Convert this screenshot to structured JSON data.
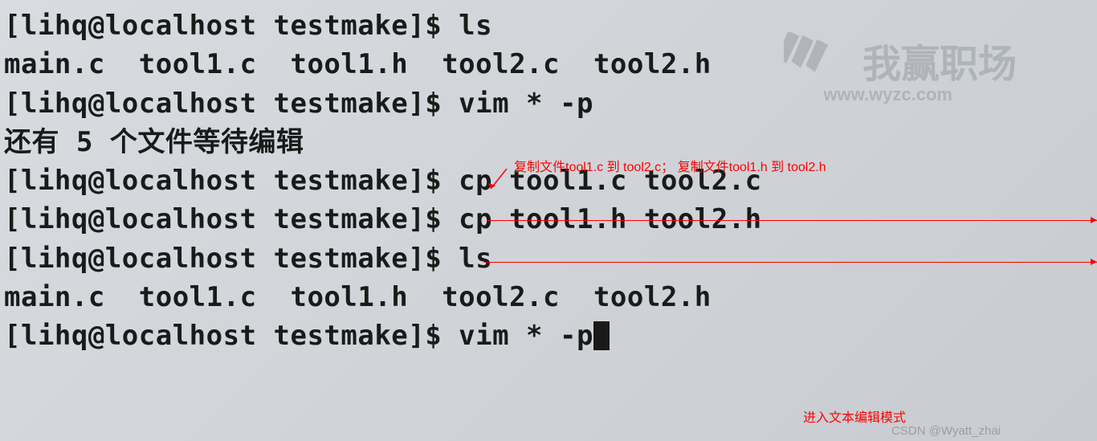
{
  "terminal": {
    "lines": [
      "[lihq@localhost testmake]$ ls",
      "main.c  tool1.c  tool1.h  tool2.c  tool2.h",
      "[lihq@localhost testmake]$ vim * -p",
      "还有 5 个文件等待编辑",
      "[lihq@localhost testmake]$ cp tool1.c tool2.c",
      "[lihq@localhost testmake]$ cp tool1.h tool2.h",
      "[lihq@localhost testmake]$ ls",
      "main.c  tool1.c  tool1.h  tool2.c  tool2.h",
      "[lihq@localhost testmake]$ vim * -p"
    ]
  },
  "annotations": {
    "copy_note": "复制文件tool1.c 到 tool2.c；    复制文件tool1.h 到 tool2.h",
    "vim_note": "进入文本编辑模式"
  },
  "watermark": {
    "text": "我赢职场",
    "url": "www.wyzc.com",
    "csdn": "CSDN @Wyatt_zhai"
  }
}
